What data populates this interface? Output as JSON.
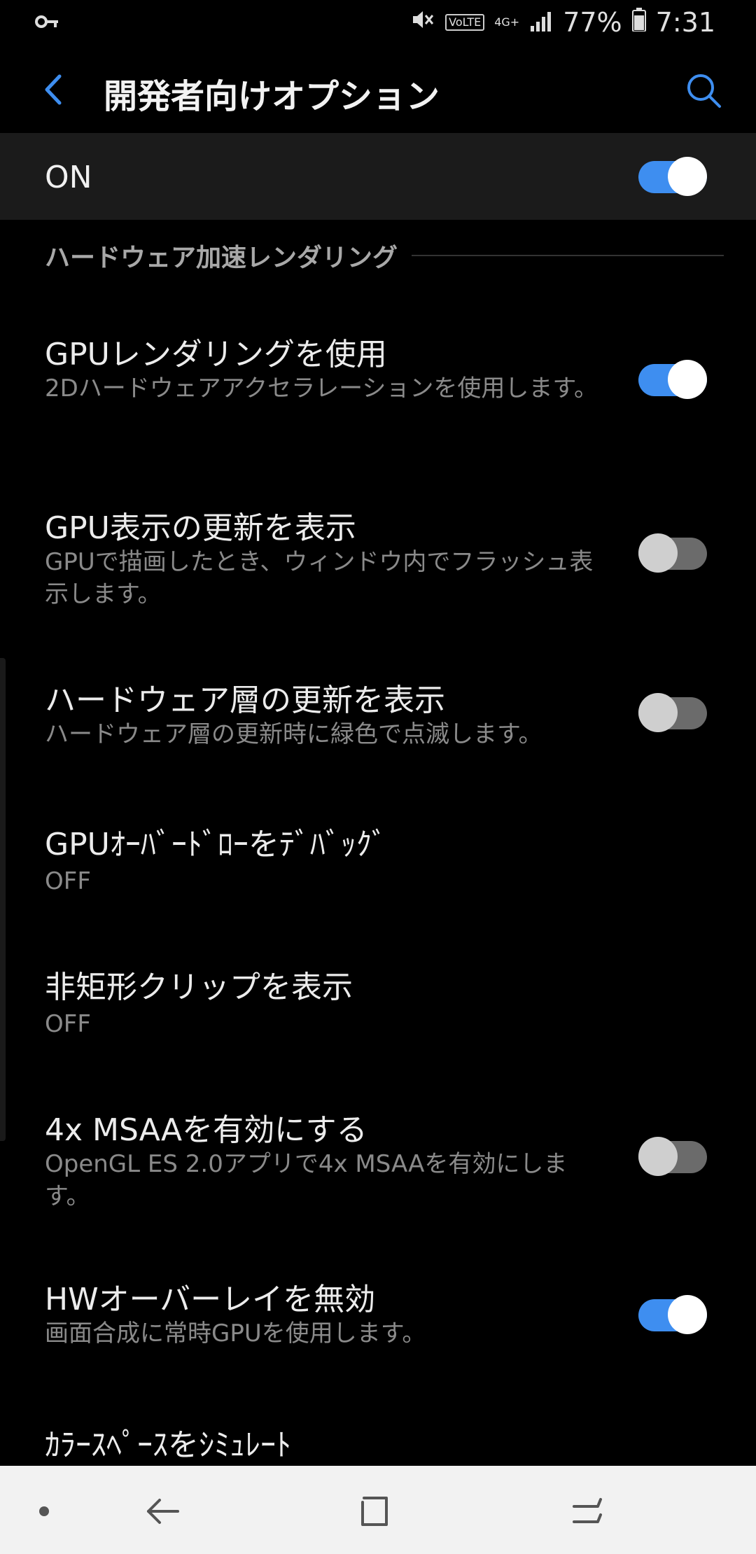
{
  "status_bar": {
    "volte": "VoLTE",
    "network": "4G+",
    "battery": "77%",
    "time": "7:31"
  },
  "header": {
    "title": "開発者向けオプション"
  },
  "master_switch": {
    "label": "ON",
    "state": "on"
  },
  "section": {
    "title": "ハードウェア加速レンダリング"
  },
  "items": [
    {
      "title": "GPUレンダリングを使用",
      "subtitle": "2Dハードウェアアクセラレーションを使用します。",
      "toggle": "on"
    },
    {
      "title": "GPU表示の更新を表示",
      "subtitle": "GPUで描画したとき、ウィンドウ内でフラッシュ表示します。",
      "toggle": "off"
    },
    {
      "title": "ハードウェア層の更新を表示",
      "subtitle": "ハードウェア層の更新時に緑色で点滅します。",
      "toggle": "off"
    },
    {
      "title": "GPUｵｰﾊﾞｰﾄﾞﾛｰをﾃﾞﾊﾞｯｸﾞ",
      "subtitle": "OFF"
    },
    {
      "title": "非矩形クリップを表示",
      "subtitle": "OFF"
    },
    {
      "title": "4x MSAAを有効にする",
      "subtitle": "OpenGL ES 2.0アプリで4x MSAAを有効にします。",
      "toggle": "off"
    },
    {
      "title": "HWオーバーレイを無効",
      "subtitle": "画面合成に常時GPUを使用します。",
      "toggle": "on"
    },
    {
      "title": "ｶﾗｰｽﾍﾟｰｽをｼﾐｭﾚｰﾄ"
    }
  ],
  "colors": {
    "accent": "#3e8ef0",
    "background": "#000000",
    "master_bg": "#1b1b1b"
  }
}
